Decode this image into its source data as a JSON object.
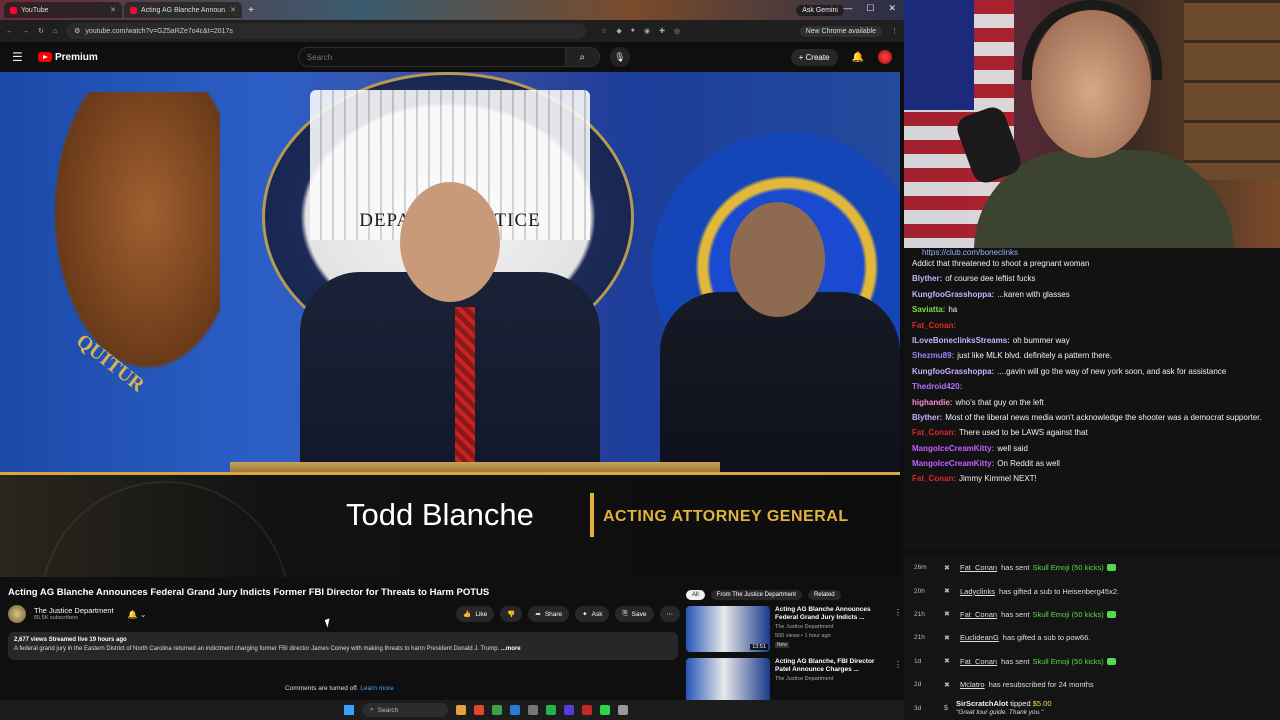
{
  "browser": {
    "tabs": [
      {
        "title": "YouTube"
      },
      {
        "title": "Acting AG Blanche Announ"
      }
    ],
    "ask_gemini": "Ask Gemini",
    "url": "youtube.com/watch?v=GZ5aRZe7o4c&t=2017s",
    "new_chrome": "New Chrome available"
  },
  "youtube": {
    "logo_label": "Premium",
    "search_placeholder": "Search",
    "create_label": "Create"
  },
  "video": {
    "doj_text": "DEPARTM        JUSTICE",
    "motto_text": "QUITUR",
    "lower_third_name": "Todd Blanche",
    "lower_third_title": "ACTING ATTORNEY GENERAL"
  },
  "info": {
    "title": "Acting AG Blanche Announces Federal Grand Jury Indicts Former FBI Director for Threats to Harm POTUS",
    "channel_name": "The Justice Department",
    "subscribers": "65.5K subscribers",
    "actions": {
      "like": "Like",
      "share": "Share",
      "ask": "Ask",
      "save": "Save"
    },
    "views_line": "2,677 views  Streamed live 19 hours ago",
    "description": "A federal grand jury in the Eastern District of North Carolina returned an indictment charging former FBI director James Comey with making threats to harm President Donald J. Trump.",
    "more_label": "...more",
    "comments_off": "Comments are turned off.",
    "learn_more": "Learn more"
  },
  "related": {
    "chips": [
      "All",
      "From The Justice Department",
      "Related"
    ],
    "items": [
      {
        "title": "Acting AG Blanche Announces Federal Grand Jury Indicts ...",
        "channel": "The Justice Department",
        "meta": "500 views • 1 hour ago",
        "badge": "New",
        "duration": "13:51"
      },
      {
        "title": "Acting AG Blanche, FBI Director Patel Announce Charges ...",
        "channel": "The Justice Department",
        "meta": "",
        "badge": "",
        "duration": ""
      }
    ]
  },
  "taskbar": {
    "search": "Search"
  },
  "chat": {
    "link": "https://club.com/boneclinks",
    "messages": [
      {
        "user": "",
        "text": "Addict that threatened to shoot a pregnant woman",
        "color": "#f1f1f1"
      },
      {
        "user": "Blyther:",
        "text": "of course dee leftist fucks",
        "color": "#c8b0ff"
      },
      {
        "user": "KungfooGrasshoppa:",
        "text": "...karen with glasses",
        "color": "#c8b0ff"
      },
      {
        "user": "Saviatta:",
        "text": "ha",
        "color": "#8ad84a"
      },
      {
        "user": "Fat_Conan:",
        "text": "",
        "color": "#e02828"
      },
      {
        "user": "ILoveBoneclinksStreams:",
        "text": "oh bummer way",
        "color": "#c8b0ff"
      },
      {
        "user": "Shezmu89:",
        "text": "just like MLK blvd. definitely a pattern there.",
        "color": "#a080ff"
      },
      {
        "user": "KungfooGrasshoppa:",
        "text": "....gavin will go the way of new york soon, and ask for assistance",
        "color": "#c8b0ff"
      },
      {
        "user": "Thedroid420:",
        "text": "",
        "color": "#b070ff"
      },
      {
        "user": "highandie:",
        "text": "who's that guy on the left",
        "color": "#ff8ad8"
      },
      {
        "user": "Blyther:",
        "text": "Most of the liberal news media won't acknowledge the shooter was a democrat supporter.",
        "color": "#c8b0ff"
      },
      {
        "user": "Fat_Conan:",
        "text": "There used to be LAWS against that",
        "color": "#e02828"
      },
      {
        "user": "MangoIceCreamKitty:",
        "text": "well said",
        "color": "#c060ff"
      },
      {
        "user": "MangoIceCreamKitty:",
        "text": "On Reddit as well",
        "color": "#c060ff"
      },
      {
        "user": "Fat_Conan:",
        "text": "Jimmy Kimmel NEXT!",
        "color": "#e02828"
      }
    ]
  },
  "events": [
    {
      "time": "26m",
      "user": "Fat_Conan",
      "text": "has sent",
      "highlight": "Skull Emoji (50 kicks)",
      "coin": true
    },
    {
      "time": "20h",
      "user": "Ladyclinks",
      "text": "has gifted a sub to Heisenberg45x2.",
      "highlight": "",
      "coin": false
    },
    {
      "time": "21h",
      "user": "Fat_Conan",
      "text": "has sent",
      "highlight": "Skull Emoji (50 kicks)",
      "coin": true
    },
    {
      "time": "21h",
      "user": "EuclideanG",
      "text": "has gifted a sub to pow66.",
      "highlight": "",
      "coin": false
    },
    {
      "time": "1d",
      "user": "Fat_Conan",
      "text": "has sent",
      "highlight": "Skull Emoji (50 kicks)",
      "coin": true
    },
    {
      "time": "2d",
      "user": "Mclatro",
      "text": "has resubscribed for 24 months",
      "highlight": "",
      "coin": false
    }
  ],
  "tip": {
    "time": "3d",
    "user": "SirScratchAlot",
    "text": "tipped",
    "amount": "$5.00",
    "quote": "\"Great tour guide. Thank you.\""
  }
}
